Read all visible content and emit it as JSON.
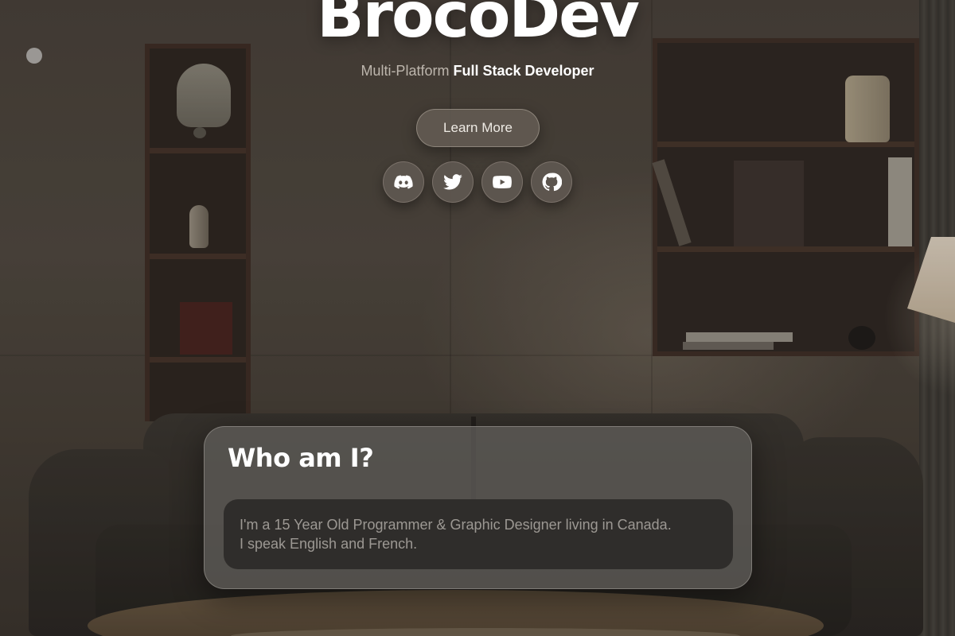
{
  "brand": {
    "name": "BrocoDev",
    "tagline_prefix": "Multi-Platform",
    "tagline_emphasis": "Full Stack Developer"
  },
  "cta": {
    "learn_more_label": "Learn More"
  },
  "socials": [
    {
      "icon": "discord-icon"
    },
    {
      "icon": "twitter-icon"
    },
    {
      "icon": "youtube-icon"
    },
    {
      "icon": "github-icon"
    }
  ],
  "about": {
    "title": "Who am I?",
    "lines": [
      "I'm a 15 Year Old Programmer & Graphic Designer living in Canada.",
      "I speak English and French."
    ]
  },
  "colors": {
    "text_primary": "#ffffff",
    "text_muted": "#bdb6ad",
    "glass_button": "#645c54",
    "card_body": "#2c2a28"
  }
}
